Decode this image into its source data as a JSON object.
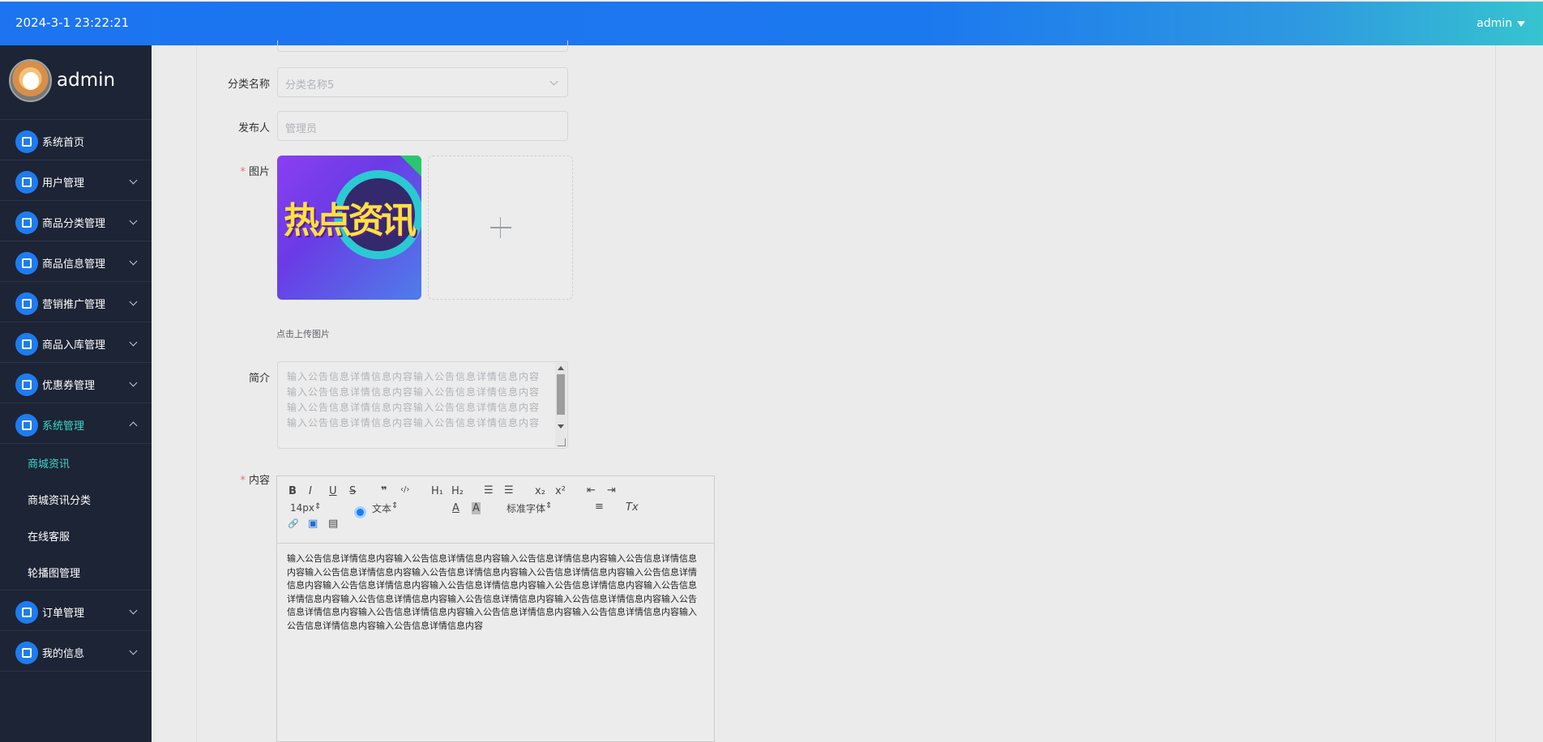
{
  "header": {
    "datetime": "2024-3-1 23:22:21",
    "user": "admin"
  },
  "brand": {
    "name": "admin"
  },
  "sidebar": {
    "items": [
      {
        "label": "系统首页",
        "icon": "home-icon"
      },
      {
        "label": "用户管理",
        "icon": "user-icon"
      },
      {
        "label": "商品分类管理",
        "icon": "grid-icon"
      },
      {
        "label": "商品信息管理",
        "icon": "book-icon"
      },
      {
        "label": "营销推广管理",
        "icon": "location-icon"
      },
      {
        "label": "商品入库管理",
        "icon": "grid-icon"
      },
      {
        "label": "优惠券管理",
        "icon": "clipboard-icon"
      },
      {
        "label": "系统管理",
        "icon": "grid-icon"
      },
      {
        "label": "订单管理",
        "icon": "grid-icon"
      },
      {
        "label": "我的信息",
        "icon": "card-icon"
      }
    ],
    "system_sub": [
      "商城资讯",
      "商城资讯分类",
      "在线客服",
      "轮播图管理"
    ]
  },
  "form": {
    "category": {
      "label": "分类名称",
      "value": "分类名称5"
    },
    "publisher": {
      "label": "发布人",
      "value": "管理员"
    },
    "image": {
      "label": "图片",
      "thumb_text": "热点资讯",
      "tip": "点击上传图片"
    },
    "intro": {
      "label": "简介",
      "value": "输入公告信息详情信息内容输入公告信息详情信息内容输入公告信息详情信息内容输入公告信息详情信息内容输入公告信息详情信息内容输入公告信息详情信息内容输入公告信息详情信息内容输入公告信息详情信息内容"
    },
    "content": {
      "label": "内容",
      "font_size": "14px",
      "text_style": "文本",
      "font_family": "标准字体",
      "toolbar": {
        "bold": "B",
        "italic": "I",
        "underline": "U",
        "strike": "S",
        "quote": "❞",
        "code": "‹/›",
        "h1": "H₁",
        "h2": "H₂",
        "ol": "☰",
        "ul": "☰",
        "sub": "x₂",
        "sup": "x²",
        "outdent": "⇤",
        "indent": "⇥",
        "color": "A",
        "bg": "A",
        "align": "≡",
        "clear": "Tx",
        "link": "🔗",
        "image": "▣",
        "video": "▤"
      },
      "body": "输入公告信息详情信息内容输入公告信息详情信息内容输入公告信息详情信息内容输入公告信息详情信息内容输入公告信息详情信息内容输入公告信息详情信息内容输入公告信息详情信息内容输入公告信息详情信息内容输入公告信息详情信息内容输入公告信息详情信息内容输入公告信息详情信息内容输入公告信息详情信息内容输入公告信息详情信息内容输入公告信息详情信息内容输入公告信息详情信息内容输入公告信息详情信息内容输入公告信息详情信息内容输入公告信息详情信息内容输入公告信息详情信息内容输入公告信息详情信息内容输入公告信息详情信息内容"
    }
  }
}
